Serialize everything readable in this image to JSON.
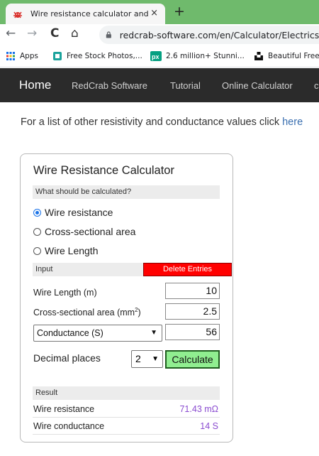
{
  "browser": {
    "tab_title": "Wire resistance calculator and fo",
    "tab_close": "×",
    "new_tab": "+",
    "url": "redcrab-software.com/en/Calculator/Electrics/Wi",
    "nav": {
      "back": "←",
      "forward": "→",
      "reload": "C",
      "home": "⌂"
    }
  },
  "bookmarks": [
    {
      "label": "Apps",
      "icon": "apps-grid-icon",
      "color": "#1a73e8"
    },
    {
      "label": "Free Stock Photos,...",
      "icon": "stock-photos-icon",
      "color": "#1ba39c"
    },
    {
      "label": "2.6 million+ Stunni...",
      "icon": "pexels-icon",
      "color": "#05a081"
    },
    {
      "label": "Beautiful Free",
      "icon": "unsplash-icon",
      "color": "#111111"
    }
  ],
  "site_nav": {
    "home": "Home",
    "items": [
      "RedCrab Software",
      "Tutorial",
      "Online Calculator",
      "c"
    ]
  },
  "intro": {
    "text": "For a list of other resistivity and conductance values click ",
    "link": "here"
  },
  "calculator": {
    "title": "Wire Resistance Calculator",
    "question": "What should be calculated?",
    "options": [
      {
        "label": "Wire resistance",
        "checked": true
      },
      {
        "label": "Cross-sectional area",
        "checked": false
      },
      {
        "label": "Wire Length",
        "checked": false
      }
    ],
    "input_header": "Input",
    "delete_label": "Delete Entries",
    "fields": {
      "length_label": "Wire Length (m)",
      "length_value": "10",
      "area_label": "Cross-sectional area (mm",
      "area_sup": "2",
      "area_close": ")",
      "area_value": "2.5",
      "conductance_select": "Conductance (S)",
      "conductance_value": "56"
    },
    "decimals_label": "Decimal places",
    "decimals_value": "2",
    "calculate_label": "Calculate",
    "result_header": "Result",
    "results": [
      {
        "label": "Wire resistance",
        "value": "71.43 mΩ"
      },
      {
        "label": "Wire conductance",
        "value": "14 S"
      }
    ]
  },
  "colors": {
    "tabstrip": "#6fba6c",
    "delete_button": "#ff0000",
    "calculate_button": "#90ee90",
    "result_value": "#8a4bd0",
    "link": "#3a6fb0"
  }
}
